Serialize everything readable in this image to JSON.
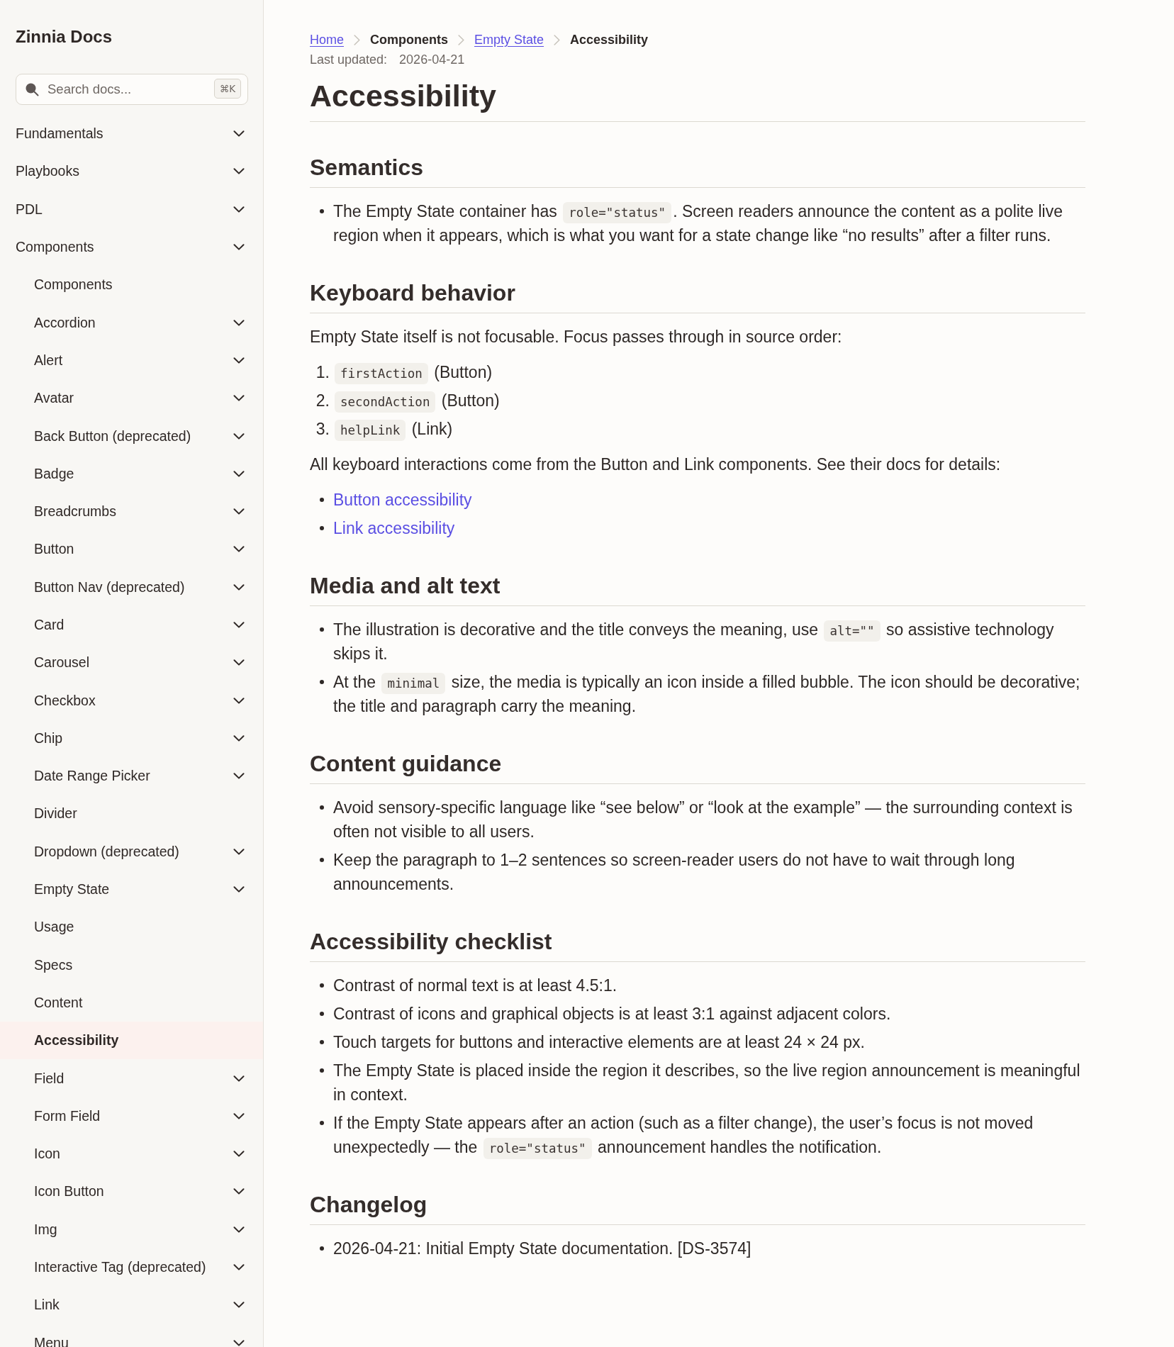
{
  "sidebar": {
    "title": "Zinnia Docs",
    "search": {
      "placeholder": "Search docs...",
      "shortcut": "⌘K"
    },
    "items": [
      {
        "label": "Fundamentals",
        "expandable": true,
        "selected": false
      },
      {
        "label": "Playbooks",
        "expandable": true,
        "selected": false
      },
      {
        "label": "PDL",
        "expandable": true,
        "selected": false
      },
      {
        "label": "Components",
        "expandable": true,
        "selected": false,
        "children": [
          {
            "label": "Components",
            "expandable": false,
            "selected": false
          },
          {
            "label": "Accordion",
            "expandable": true,
            "selected": false
          },
          {
            "label": "Alert",
            "expandable": true,
            "selected": false
          },
          {
            "label": "Avatar",
            "expandable": true,
            "selected": false
          },
          {
            "label": "Back Button (deprecated)",
            "expandable": true,
            "selected": false
          },
          {
            "label": "Badge",
            "expandable": true,
            "selected": false
          },
          {
            "label": "Breadcrumbs",
            "expandable": true,
            "selected": false
          },
          {
            "label": "Button",
            "expandable": true,
            "selected": false
          },
          {
            "label": "Button Nav (deprecated)",
            "expandable": true,
            "selected": false
          },
          {
            "label": "Card",
            "expandable": true,
            "selected": false
          },
          {
            "label": "Carousel",
            "expandable": true,
            "selected": false
          },
          {
            "label": "Checkbox",
            "expandable": true,
            "selected": false
          },
          {
            "label": "Chip",
            "expandable": true,
            "selected": false
          },
          {
            "label": "Date Range Picker",
            "expandable": true,
            "selected": false
          },
          {
            "label": "Divider",
            "expandable": false,
            "selected": false
          },
          {
            "label": "Dropdown (deprecated)",
            "expandable": true,
            "selected": false
          },
          {
            "label": "Empty State",
            "expandable": true,
            "selected": false,
            "children": [
              {
                "label": "Usage",
                "expandable": false,
                "selected": false
              },
              {
                "label": "Specs",
                "expandable": false,
                "selected": false
              },
              {
                "label": "Content",
                "expandable": false,
                "selected": false
              },
              {
                "label": "Accessibility",
                "expandable": false,
                "selected": true
              }
            ]
          },
          {
            "label": "Field",
            "expandable": true,
            "selected": false
          },
          {
            "label": "Form Field",
            "expandable": true,
            "selected": false
          },
          {
            "label": "Icon",
            "expandable": true,
            "selected": false
          },
          {
            "label": "Icon Button",
            "expandable": true,
            "selected": false
          },
          {
            "label": "Img",
            "expandable": true,
            "selected": false
          },
          {
            "label": "Interactive Tag (deprecated)",
            "expandable": true,
            "selected": false
          },
          {
            "label": "Link",
            "expandable": true,
            "selected": false
          },
          {
            "label": "Menu",
            "expandable": true,
            "selected": false
          }
        ]
      }
    ]
  },
  "breadcrumbs": [
    {
      "label": "Home",
      "kind": "link"
    },
    {
      "label": "Components",
      "kind": "text"
    },
    {
      "label": "Empty State",
      "kind": "link"
    },
    {
      "label": "Accessibility",
      "kind": "text"
    }
  ],
  "last_updated": {
    "label": "Last updated:",
    "date": "2026-04-21"
  },
  "title": "Accessibility",
  "sections": [
    {
      "heading": "Semantics",
      "blocks": [
        {
          "kind": "bullets",
          "items": [
            {
              "segments": [
                {
                  "kind": "text",
                  "text": "The Empty State container has "
                },
                {
                  "kind": "code",
                  "text": "role=\"status\""
                },
                {
                  "kind": "text",
                  "text": ". Screen readers announce the content as a polite live region when it appears, which is what you want for a state change like “no results” after a filter runs."
                }
              ]
            }
          ]
        }
      ]
    },
    {
      "heading": "Keyboard behavior",
      "blocks": [
        {
          "kind": "paragraph",
          "segments": [
            {
              "kind": "text",
              "text": "Empty State itself is not focusable. Focus passes through in source order:"
            }
          ]
        },
        {
          "kind": "numbered",
          "items": [
            {
              "number": "1.",
              "segments": [
                {
                  "kind": "code",
                  "text": "firstAction"
                },
                {
                  "kind": "text",
                  "text": " (Button)"
                }
              ]
            },
            {
              "number": "2.",
              "segments": [
                {
                  "kind": "code",
                  "text": "secondAction"
                },
                {
                  "kind": "text",
                  "text": " (Button)"
                }
              ]
            },
            {
              "number": "3.",
              "segments": [
                {
                  "kind": "code",
                  "text": "helpLink"
                },
                {
                  "kind": "text",
                  "text": " (Link)"
                }
              ]
            }
          ]
        },
        {
          "kind": "paragraph",
          "segments": [
            {
              "kind": "text",
              "text": "All keyboard interactions come from the Button and Link components. See their docs for details:"
            }
          ]
        },
        {
          "kind": "links",
          "items": [
            {
              "text": "Button accessibility"
            },
            {
              "text": "Link accessibility"
            }
          ]
        }
      ]
    },
    {
      "heading": "Media and alt text",
      "blocks": [
        {
          "kind": "bullets",
          "items": [
            {
              "segments": [
                {
                  "kind": "text",
                  "text": "The illustration is decorative and the title conveys the meaning, use "
                },
                {
                  "kind": "code",
                  "text": "alt=\"\""
                },
                {
                  "kind": "text",
                  "text": " so assistive technology skips it."
                }
              ]
            },
            {
              "segments": [
                {
                  "kind": "text",
                  "text": "At the "
                },
                {
                  "kind": "code",
                  "text": "minimal"
                },
                {
                  "kind": "text",
                  "text": " size, the media is typically an icon inside a filled bubble. The icon should be decorative; the title and paragraph carry the meaning."
                }
              ]
            }
          ]
        }
      ]
    },
    {
      "heading": "Content guidance",
      "blocks": [
        {
          "kind": "bullets",
          "items": [
            {
              "segments": [
                {
                  "kind": "text",
                  "text": "Avoid sensory-specific language like “see below” or “look at the example” — the surrounding context is often not visible to all users."
                }
              ]
            },
            {
              "segments": [
                {
                  "kind": "text",
                  "text": "Keep the paragraph to 1–2 sentences so screen-reader users do not have to wait through long announcements."
                }
              ]
            }
          ]
        }
      ]
    },
    {
      "heading": "Accessibility checklist",
      "blocks": [
        {
          "kind": "bullets",
          "items": [
            {
              "segments": [
                {
                  "kind": "text",
                  "text": "Contrast of normal text is at least 4.5:1."
                }
              ]
            },
            {
              "segments": [
                {
                  "kind": "text",
                  "text": "Contrast of icons and graphical objects is at least 3:1 against adjacent colors."
                }
              ]
            },
            {
              "segments": [
                {
                  "kind": "text",
                  "text": "Touch targets for buttons and interactive elements are at least 24 × 24 px."
                }
              ]
            },
            {
              "segments": [
                {
                  "kind": "text",
                  "text": "The Empty State is placed inside the region it describes, so the live region announcement is meaningful in context."
                }
              ]
            },
            {
              "segments": [
                {
                  "kind": "text",
                  "text": "If the Empty State appears after an action (such as a filter change), the user’s focus is not moved unexpectedly — the "
                },
                {
                  "kind": "code",
                  "text": "role=\"status\""
                },
                {
                  "kind": "text",
                  "text": " announcement handles the notification."
                }
              ]
            }
          ]
        }
      ]
    },
    {
      "heading": "Changelog",
      "blocks": [
        {
          "kind": "bullets",
          "items": [
            {
              "segments": [
                {
                  "kind": "text",
                  "text": "2026-04-21: Initial Empty State documentation. [DS-3574]"
                }
              ]
            }
          ]
        }
      ]
    }
  ]
}
